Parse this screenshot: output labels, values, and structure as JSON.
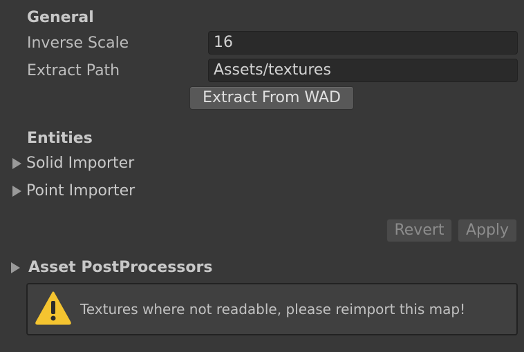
{
  "general": {
    "header": "General",
    "inverse_scale_label": "Inverse Scale",
    "inverse_scale_value": "16",
    "extract_path_label": "Extract Path",
    "extract_path_value": "Assets/textures",
    "extract_button": "Extract From WAD"
  },
  "entities": {
    "header": "Entities",
    "foldouts": [
      {
        "label": "Solid Importer"
      },
      {
        "label": "Point Importer"
      }
    ]
  },
  "actions": {
    "revert": "Revert",
    "apply": "Apply"
  },
  "postprocessors": {
    "label": "Asset PostProcessors"
  },
  "help": {
    "icon": "warning-icon",
    "message": "Textures where not readable, please reimport this map!"
  },
  "colors": {
    "background": "#383838",
    "field": "#2a2a2a",
    "warning": "#f4c430"
  }
}
